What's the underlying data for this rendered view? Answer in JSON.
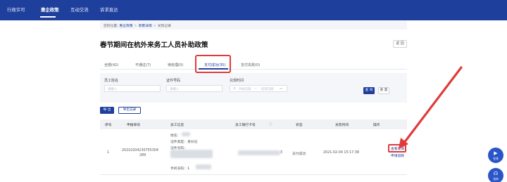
{
  "nav": {
    "items": [
      "行政许可",
      "惠企政策",
      "互动交流",
      "诉求直达"
    ],
    "active_index": 1
  },
  "breadcrumb": {
    "prefix": "您的位置:",
    "items": [
      "惠企政策",
      "政策详情",
      "兑现记录"
    ]
  },
  "page": {
    "title": "春节期间在杭外来务工人员补助政策",
    "back_label": "返 回"
  },
  "tabs": [
    {
      "label": "全部(42)"
    },
    {
      "label": "不通过(7)"
    },
    {
      "label": "待处理(0)"
    },
    {
      "label": "支付成功(35)"
    },
    {
      "label": "支付失败(0)"
    }
  ],
  "active_tab_index": 3,
  "filter": {
    "name_label": "员工姓名",
    "name_placeholder": "请输入",
    "id_label": "证件号码",
    "id_placeholder": "请输入",
    "time_label": "兑现时间",
    "start_placeholder": "开始日期",
    "to": "~",
    "end_placeholder": "结束日期",
    "query_label": "查 询",
    "reset_label": "重 置"
  },
  "actions": {
    "export_label": "导 出",
    "records_label": "导出记录"
  },
  "table": {
    "headers": [
      "序号",
      "申报单号",
      "员工信息",
      "员工银行卡号",
      "状态",
      "兑现时间",
      "操作"
    ],
    "row": {
      "index": "1",
      "order_no_line1": "20210204230755304",
      "order_no_line2": "289",
      "info_name": "姓名：",
      "info_idtype": "证件类型：身份证",
      "info_idno": "证件号码：",
      "info_phone": "手机号码：1",
      "bank_suffix": "3",
      "status": "支付成功",
      "time": "2021-02-04 15:17:38",
      "op_view": "查看详情",
      "op_apply": "申请退款"
    }
  },
  "fabs": [
    {
      "icon": "video-camera-icon",
      "label": "在线"
    },
    {
      "icon": "headset-icon",
      "label": "咨询"
    }
  ],
  "colors": {
    "brand": "#1f3f9d",
    "highlight": "#e03b3b"
  }
}
